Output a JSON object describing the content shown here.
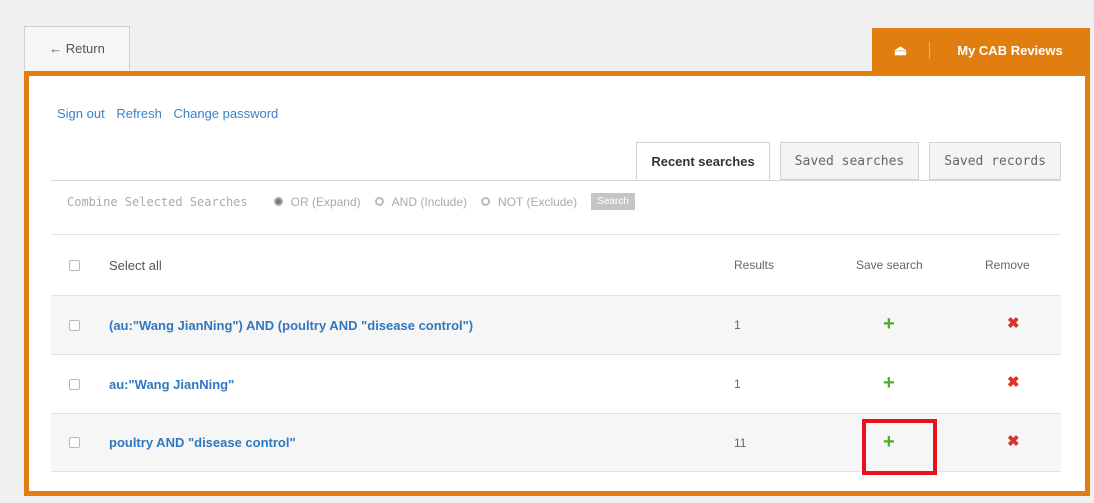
{
  "nav": {
    "return_label": "← Return",
    "reviews_icon": "⏏",
    "reviews_label": "My CAB Reviews"
  },
  "account": {
    "sign_out": "Sign out",
    "refresh": "Refresh",
    "change_password": "Change password"
  },
  "tabs": [
    {
      "label": "Recent searches",
      "active": true
    },
    {
      "label": "Saved searches",
      "active": false
    },
    {
      "label": "Saved records",
      "active": false
    }
  ],
  "combine": {
    "label": "Combine Selected Searches",
    "options": [
      "OR (Expand)",
      "AND (Include)",
      "NOT (Exclude)"
    ],
    "selected": "OR (Expand)",
    "search_button": "Search"
  },
  "table": {
    "headers": {
      "select_all": "Select all",
      "results": "Results",
      "save_search": "Save search",
      "remove": "Remove"
    },
    "rows": [
      {
        "query": "(au:\"Wang JianNing\") AND (poultry AND \"disease control\")",
        "results": "1"
      },
      {
        "query": "au:\"Wang JianNing\"",
        "results": "1"
      },
      {
        "query": "poultry AND \"disease control\"",
        "results": "11"
      }
    ]
  },
  "icons": {
    "add": "+",
    "remove": "✖"
  },
  "colors": {
    "accent": "#e07f10",
    "link": "#2f78c0",
    "add": "#4caf2a",
    "remove": "#d9342b",
    "highlight": "#e8121c"
  }
}
